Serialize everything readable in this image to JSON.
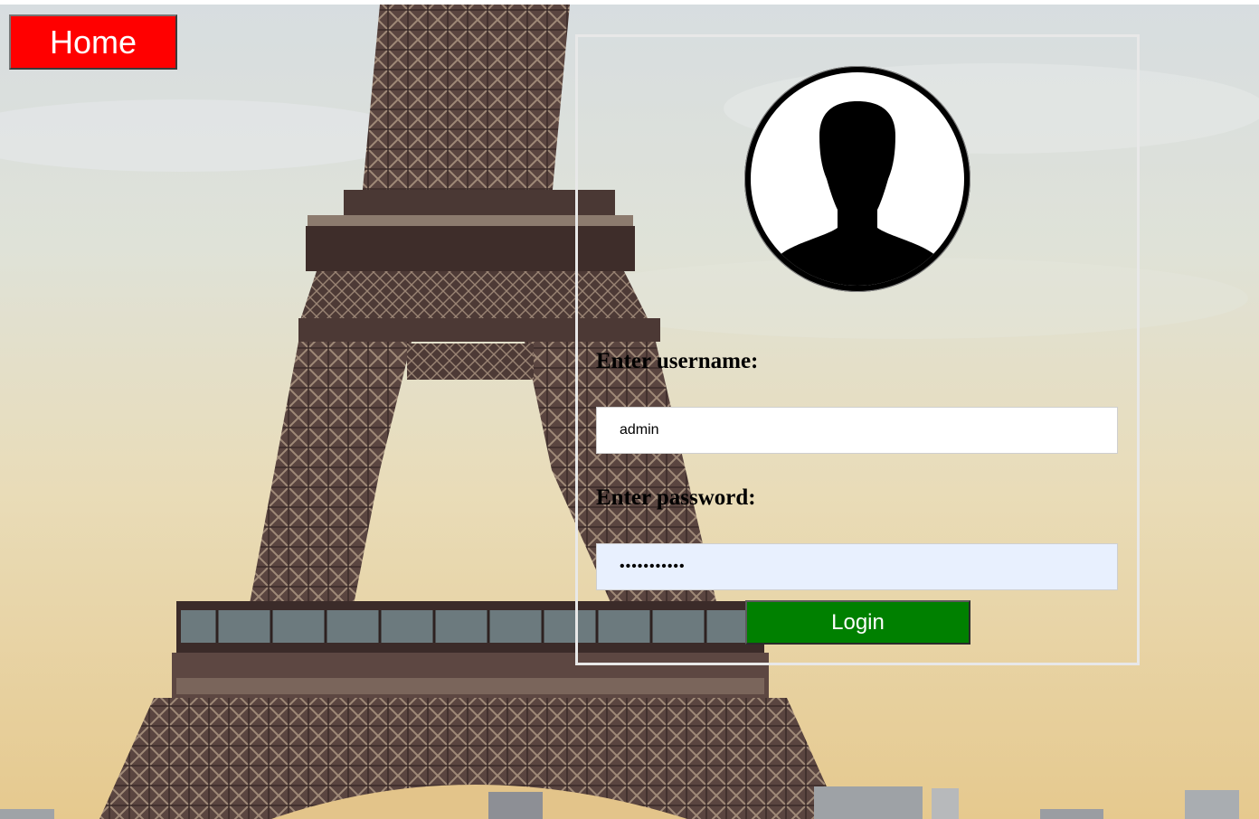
{
  "nav": {
    "home_label": "Home"
  },
  "login": {
    "avatar_icon": "user-silhouette-icon",
    "username_label": "Enter username:",
    "username_value": "admin",
    "password_label": "Enter password:",
    "password_value": "•••••••••••",
    "submit_label": "Login"
  },
  "colors": {
    "home_button": "#ff0000",
    "login_button": "#008000",
    "password_autofill_bg": "#e8f0fe",
    "panel_border": "#e8e8e8"
  }
}
